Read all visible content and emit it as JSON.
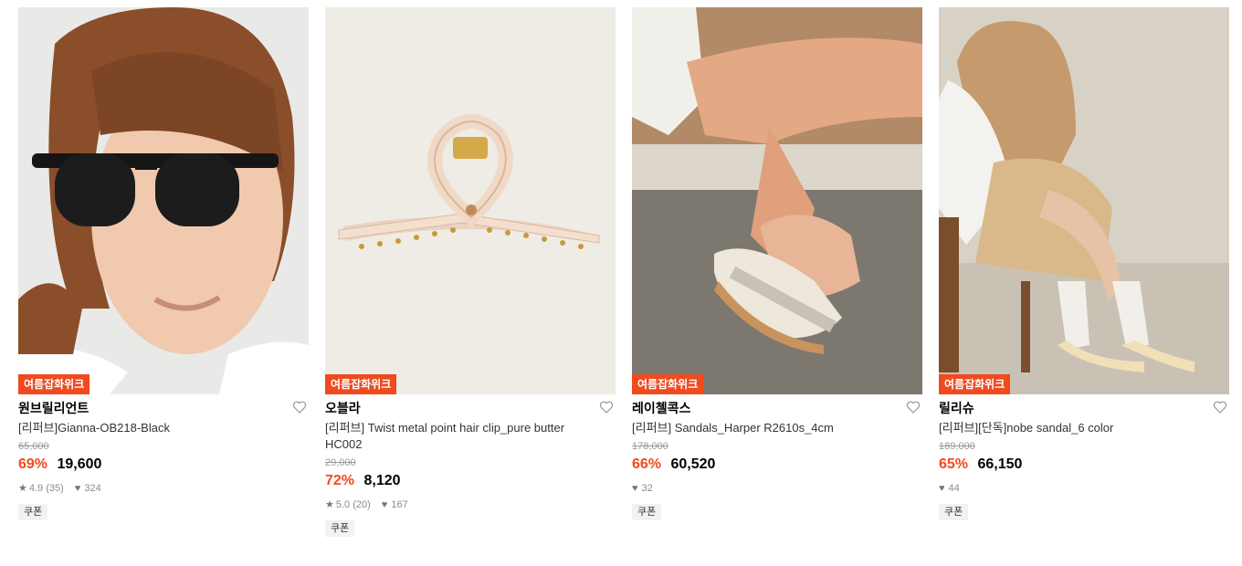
{
  "products": [
    {
      "event_badge": "여름잡화위크",
      "brand": "원브릴리언트",
      "name": "[리퍼브]Gianna-OB218-Black",
      "original_price": "65,000",
      "discount": "69%",
      "price": "19,600",
      "rating": "4.9 (35)",
      "likes": "324",
      "coupon": "쿠폰"
    },
    {
      "event_badge": "여름잡화위크",
      "brand": "오블라",
      "name": "[리퍼브] Twist metal point hair clip_pure butter HC002",
      "original_price": "29,000",
      "discount": "72%",
      "price": "8,120",
      "rating": "5.0 (20)",
      "likes": "167",
      "coupon": "쿠폰"
    },
    {
      "event_badge": "여름잡화위크",
      "brand": "레이첼콕스",
      "name": "[리퍼브] Sandals_Harper R2610s_4cm",
      "original_price": "178,000",
      "discount": "66%",
      "price": "60,520",
      "likes": "32",
      "coupon": "쿠폰"
    },
    {
      "event_badge": "여름잡화위크",
      "brand": "릴리슈",
      "name": "[리퍼브][단독]nobe sandal_6 color",
      "original_price": "189,000",
      "discount": "65%",
      "price": "66,150",
      "likes": "44",
      "coupon": "쿠폰"
    }
  ],
  "icons": {
    "heart": "heart-outline-icon",
    "star": "star-icon",
    "like": "heart-filled-icon"
  },
  "colors": {
    "accent": "#f04a1e",
    "muted": "#8a8a8a"
  }
}
